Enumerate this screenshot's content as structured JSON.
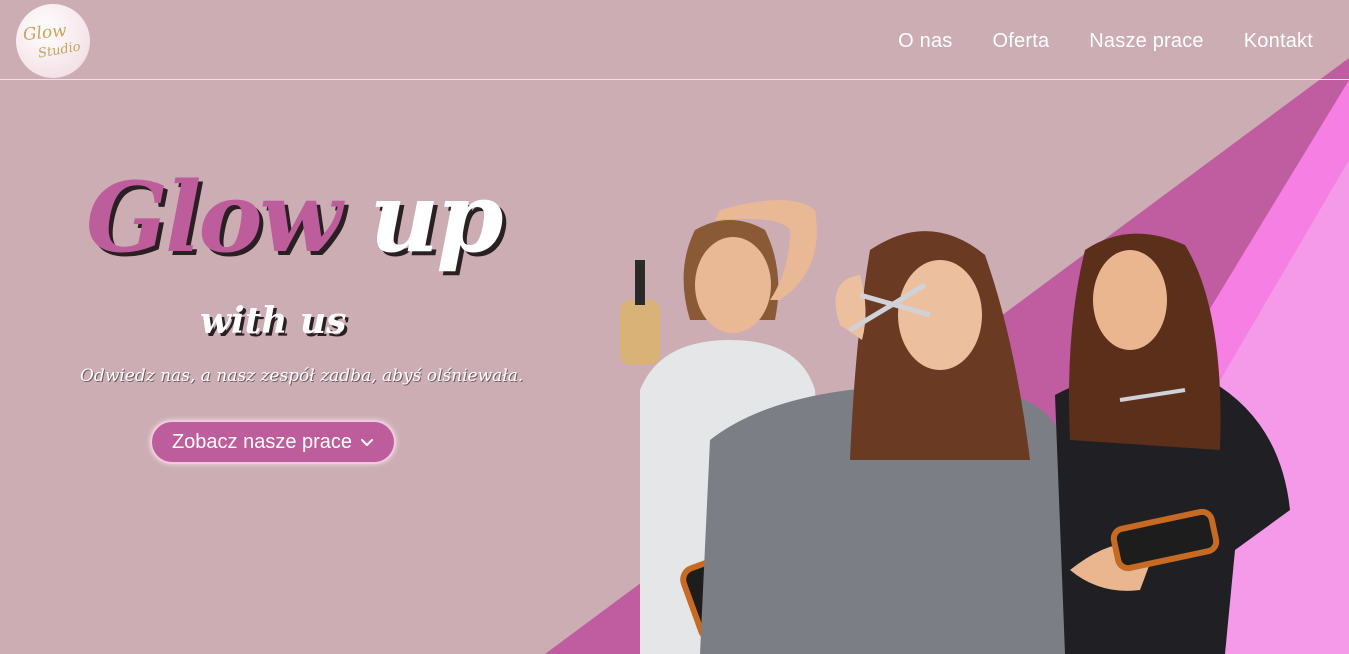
{
  "brand": {
    "logo_line1": "Glow",
    "logo_line2": "Studio"
  },
  "nav": {
    "items": [
      "O nas",
      "Oferta",
      "Nasze prace",
      "Kontakt"
    ]
  },
  "hero": {
    "title_part1": "Glow",
    "title_part2": "up",
    "subtitle": "with us",
    "tagline": "Odwiedz nas, a nasz zespół zadba, abyś olśniewała.",
    "cta_label": "Zobacz nasze prace"
  },
  "icons": {
    "cta_icon": "chevron-down-icon"
  },
  "colors": {
    "background": "#cbadb3",
    "accent": "#bd5d9c",
    "triangle_light": "#f49ae8",
    "triangle_bright": "#f57fe3",
    "triangle_dark": "#bf5da0"
  }
}
